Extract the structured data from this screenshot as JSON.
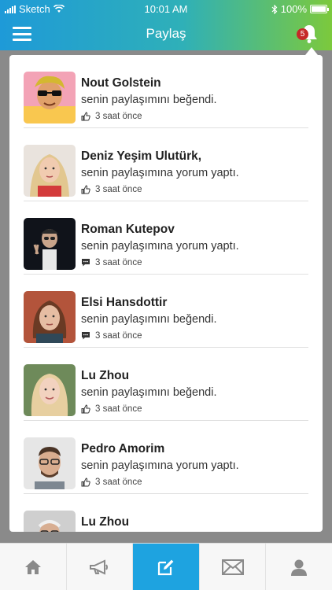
{
  "status": {
    "carrier": "Sketch",
    "time": "10:01 AM",
    "battery": "100%"
  },
  "header": {
    "title": "Paylaş",
    "notification_count": "5"
  },
  "notifications": [
    {
      "name": "Nout Golstein",
      "action": "senin paylaşımını beğendi.",
      "time": "3 saat önce",
      "type": "like"
    },
    {
      "name": "Deniz Yeşim Ulutürk,",
      "action": "senin paylaşımına yorum yaptı.",
      "time": "3 saat önce",
      "type": "like"
    },
    {
      "name": "Roman Kutepov",
      "action": "senin paylaşımına yorum yaptı.",
      "time": "3 saat önce",
      "type": "comment"
    },
    {
      "name": "Elsi Hansdottir",
      "action": "senin paylaşımını beğendi.",
      "time": "3 saat önce",
      "type": "comment"
    },
    {
      "name": "Lu Zhou",
      "action": "senin paylaşımını beğendi.",
      "time": "3 saat önce",
      "type": "like"
    },
    {
      "name": "Pedro Amorim",
      "action": "senin paylaşımına yorum yaptı.",
      "time": "3 saat önce",
      "type": "like"
    },
    {
      "name": "Lu Zhou",
      "action": "",
      "time": "",
      "type": ""
    }
  ],
  "tabs": [
    {
      "icon": "home-icon"
    },
    {
      "icon": "megaphone-icon"
    },
    {
      "icon": "compose-icon",
      "active": true
    },
    {
      "icon": "mail-icon"
    },
    {
      "icon": "profile-icon"
    }
  ],
  "colors": {
    "accent": "#1ea3e0",
    "badge": "#c62828",
    "gradient_start": "#1e9ad8",
    "gradient_end": "#7cc93c"
  }
}
